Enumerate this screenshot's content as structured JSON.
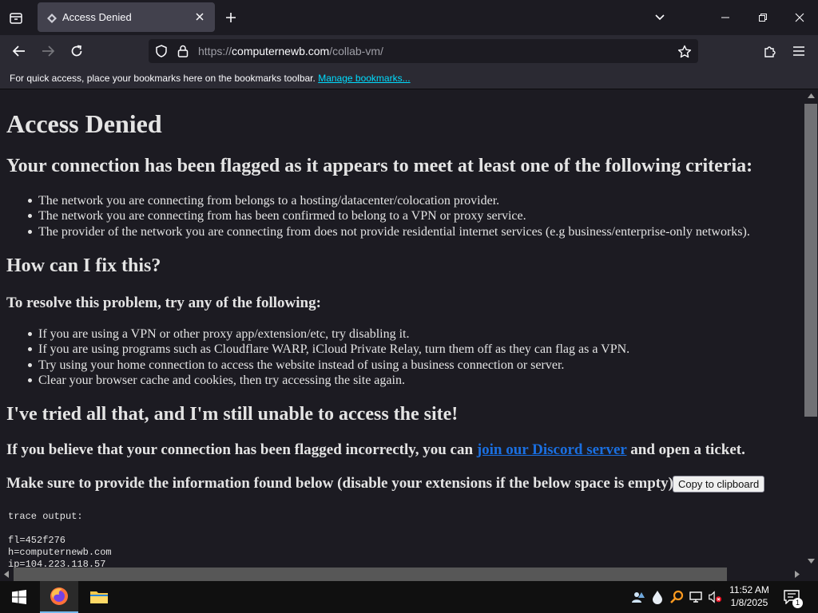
{
  "browser": {
    "tab": {
      "title": "Access Denied"
    },
    "url": {
      "scheme": "https://",
      "domain": "computernewb.com",
      "path": "/collab-vm/"
    },
    "bookmarks_bar": {
      "text": "For quick access, place your bookmarks here on the bookmarks toolbar.",
      "link": "Manage bookmarks..."
    }
  },
  "page": {
    "title": "Access Denied",
    "flagged_heading": "Your connection has been flagged as it appears to meet at least one of the following criteria:",
    "criteria": [
      "The network you are connecting from belongs to a hosting/datacenter/colocation provider.",
      "The network you are connecting from has been confirmed to belong to a VPN or proxy service.",
      "The provider of the network you are connecting from does not provide residential internet services (e.g business/enterprise-only networks)."
    ],
    "fix_heading": "How can I fix this?",
    "resolve_heading": "To resolve this problem, try any of the following:",
    "fixes": [
      "If you are using a VPN or other proxy app/extension/etc, try disabling it.",
      "If you are using programs such as Cloudflare WARP, iCloud Private Relay, turn them off as they can flag as a VPN.",
      "Try using your home connection to access the website instead of using a business connection or server.",
      "Clear your browser cache and cookies, then try accessing the site again."
    ],
    "tried_heading": "I've tried all that, and I'm still unable to access the site!",
    "discord_before": "If you believe that your connection has been flagged incorrectly, you can ",
    "discord_link": "join our Discord server",
    "discord_after": " and open a ticket.",
    "info_heading": "Make sure to provide the information found below (disable your extensions if the below space is empty):",
    "copy_button": "Copy to clipboard",
    "trace": {
      "label": "trace output:",
      "fl": "fl=452f276",
      "h": "h=computernewb.com",
      "ip": "ip=104.223.118.57"
    }
  },
  "taskbar": {
    "time": "11:52 AM",
    "date": "1/8/2025",
    "notification_count": "1"
  }
}
